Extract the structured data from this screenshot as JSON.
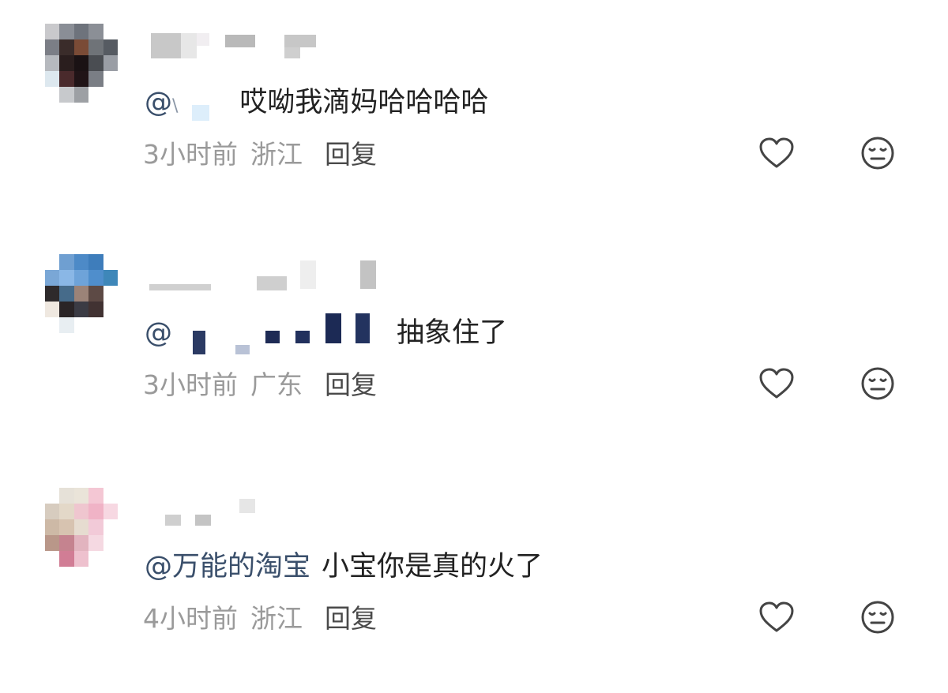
{
  "comments": [
    {
      "mention_prefix": "@",
      "mention_partial": "\\",
      "text": "哎呦我滴妈哈哈哈哈",
      "time": "3小时前",
      "location": "浙江",
      "reply_label": "回复",
      "like_icon": "heart-outline-icon",
      "dislike_icon": "neutral-face-icon"
    },
    {
      "mention_prefix": "@",
      "mention_partial": "",
      "text": "抽象住了",
      "time": "3小时前",
      "location": "广东",
      "reply_label": "回复",
      "like_icon": "heart-outline-icon",
      "dislike_icon": "neutral-face-icon"
    },
    {
      "mention_prefix": "@万能的淘宝",
      "mention_partial": "",
      "text": "小宝你是真的火了",
      "time": "4小时前",
      "location": "浙江",
      "reply_label": "回复",
      "like_icon": "heart-outline-icon",
      "dislike_icon": "neutral-face-icon"
    }
  ],
  "colors": {
    "mention": "#3a4f6b",
    "body_text": "#222222",
    "meta_text": "#9a9a9a",
    "reply_text": "#4a4a4a",
    "icon_stroke": "#444444"
  }
}
